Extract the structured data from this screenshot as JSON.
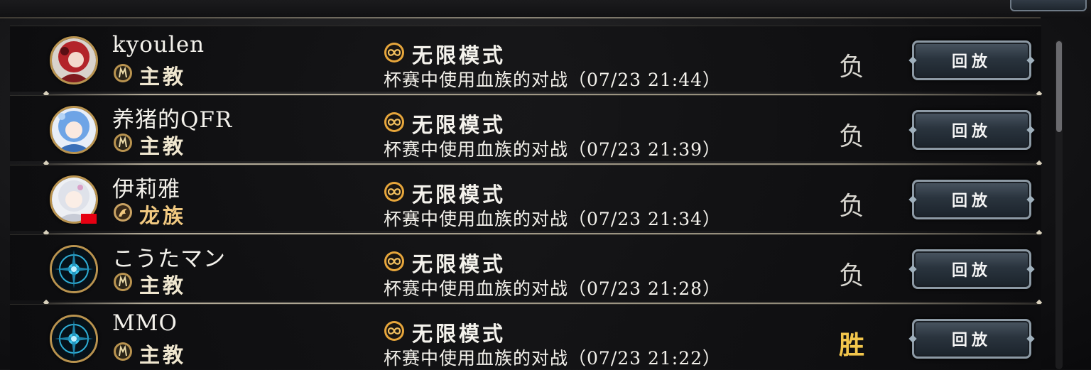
{
  "battle_history": {
    "rows": [
      {
        "player_name": "kyoulen",
        "class_label": "主教",
        "class_icon": "bishop-crest-icon",
        "mode_label": "无限模式",
        "mode_icon": "infinity-icon",
        "description": "杯赛中使用血族的对战（07/23 21:44）",
        "result": "负",
        "replay_label": "回放",
        "avatar": "red-haired-character-avatar"
      },
      {
        "player_name": "养猪的QFR",
        "class_label": "主教",
        "class_icon": "bishop-crest-icon",
        "mode_label": "无限模式",
        "mode_icon": "infinity-icon",
        "description": "杯赛中使用血族的对战（07/23 21:39）",
        "result": "负",
        "replay_label": "回放",
        "avatar": "blue-haired-character-avatar"
      },
      {
        "player_name": "伊莉雅",
        "class_label": "龙族",
        "class_icon": "dragon-crest-icon",
        "mode_label": "无限模式",
        "mode_icon": "infinity-icon",
        "description": "杯赛中使用血族的对战（07/23 21:34）",
        "result": "负",
        "replay_label": "回放",
        "avatar": "white-haired-character-avatar",
        "flag": "china-flag-icon"
      },
      {
        "player_name": "こうたマン",
        "class_label": "主教",
        "class_icon": "bishop-crest-icon",
        "mode_label": "无限模式",
        "mode_icon": "infinity-icon",
        "description": "杯赛中使用血族的对战（07/23 21:28）",
        "result": "负",
        "replay_label": "回放",
        "avatar": "default-emblem-avatar"
      },
      {
        "player_name": "MMO",
        "class_label": "主教",
        "class_icon": "bishop-crest-icon",
        "mode_label": "无限模式",
        "mode_icon": "infinity-icon",
        "description": "杯赛中使用血族的对战（07/23 21:22）",
        "result": "胜",
        "replay_label": "回放",
        "avatar": "default-emblem-avatar"
      }
    ]
  },
  "colors": {
    "loss": "#d9d7d0",
    "win": "#f2c64c",
    "dragon_class": "#f0c880",
    "avatar_border": "#b9934f",
    "button_border": "#8d9aa5"
  }
}
